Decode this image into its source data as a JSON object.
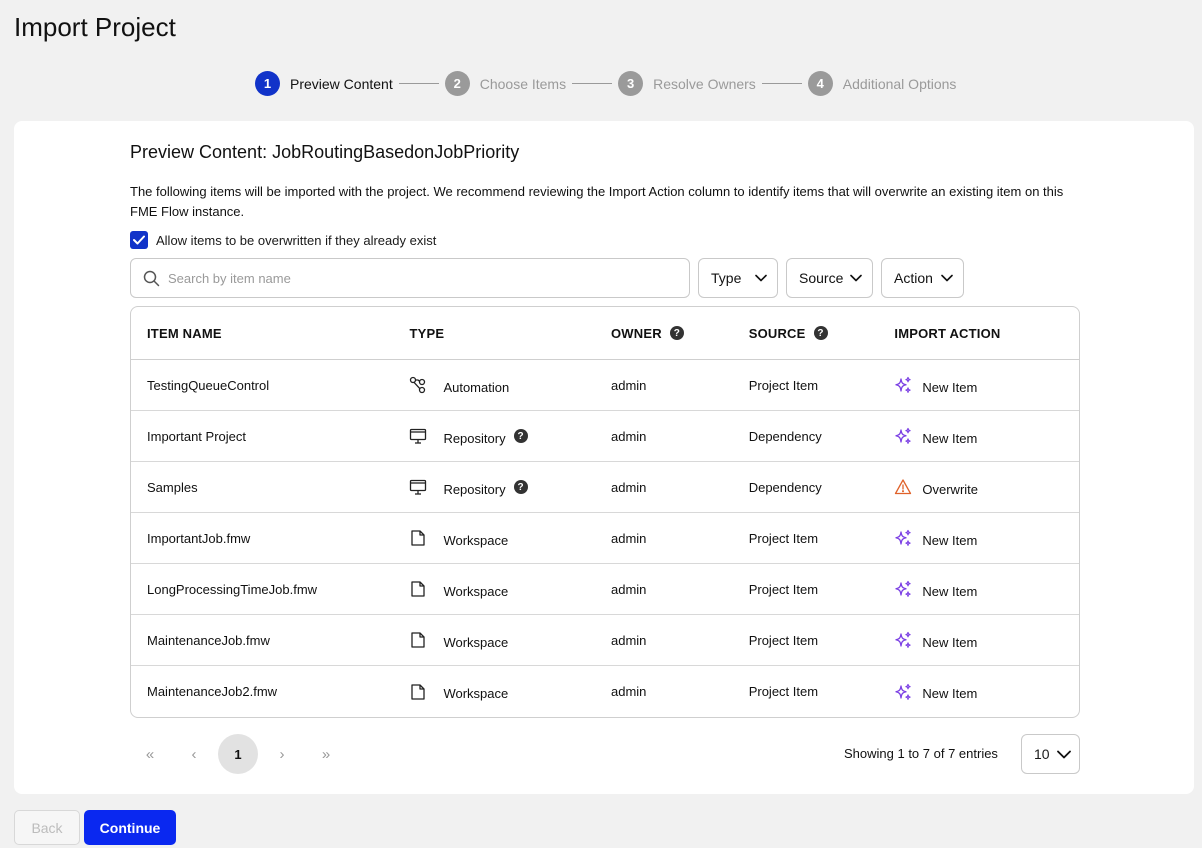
{
  "page": {
    "title": "Import Project"
  },
  "stepper": {
    "steps": [
      {
        "number": "1",
        "label": "Preview Content"
      },
      {
        "number": "2",
        "label": "Choose Items"
      },
      {
        "number": "3",
        "label": "Resolve Owners"
      },
      {
        "number": "4",
        "label": "Additional Options"
      }
    ],
    "active_step": 1
  },
  "preview": {
    "title": "Preview Content: JobRoutingBasedonJobPriority",
    "description": "The following items will be imported with the project. We recommend reviewing the Import Action column to identify items that will overwrite an existing item on this FME Flow instance.",
    "overwrite_label": "Allow items to be overwritten if they already exist",
    "overwrite_checked": true
  },
  "search": {
    "placeholder": "Search by item name",
    "value": ""
  },
  "filters": {
    "type": "Type",
    "source": "Source",
    "action": "Action"
  },
  "table": {
    "headers": {
      "name": "ITEM NAME",
      "type": "TYPE",
      "owner": "OWNER",
      "source": "SOURCE",
      "action": "IMPORT ACTION"
    },
    "rows": [
      {
        "name": "TestingQueueControl",
        "type": "Automation",
        "type_icon": "automation-icon",
        "owner": "admin",
        "source": "Project Item",
        "action": "New Item",
        "action_icon": "sparkle-icon"
      },
      {
        "name": "Important Project",
        "type": "Repository",
        "type_icon": "repository-icon",
        "owner": "admin",
        "source": "Dependency",
        "action": "New Item",
        "action_icon": "sparkle-icon"
      },
      {
        "name": "Samples",
        "type": "Repository",
        "type_icon": "repository-icon",
        "owner": "admin",
        "source": "Dependency",
        "action": "Overwrite",
        "action_icon": "warning-icon"
      },
      {
        "name": "ImportantJob.fmw",
        "type": "Workspace",
        "type_icon": "workspace-icon",
        "owner": "admin",
        "source": "Project Item",
        "action": "New Item",
        "action_icon": "sparkle-icon"
      },
      {
        "name": "LongProcessingTimeJob.fmw",
        "type": "Workspace",
        "type_icon": "workspace-icon",
        "owner": "admin",
        "source": "Project Item",
        "action": "New Item",
        "action_icon": "sparkle-icon"
      },
      {
        "name": "MaintenanceJob.fmw",
        "type": "Workspace",
        "type_icon": "workspace-icon",
        "owner": "admin",
        "source": "Project Item",
        "action": "New Item",
        "action_icon": "sparkle-icon"
      },
      {
        "name": "MaintenanceJob2.fmw",
        "type": "Workspace",
        "type_icon": "workspace-icon",
        "owner": "admin",
        "source": "Project Item",
        "action": "New Item",
        "action_icon": "sparkle-icon"
      }
    ]
  },
  "pagination": {
    "first": "«",
    "prev": "‹",
    "current": "1",
    "next": "›",
    "last": "»",
    "summary": "Showing 1 to 7 of 7 entries",
    "page_size": "10"
  },
  "footer": {
    "back_label": "Back",
    "continue_label": "Continue"
  },
  "colors": {
    "primary": "#0a28f0",
    "step_active": "#1133c9",
    "sparkle": "#7b3fe4",
    "warning": "#e0622a"
  }
}
